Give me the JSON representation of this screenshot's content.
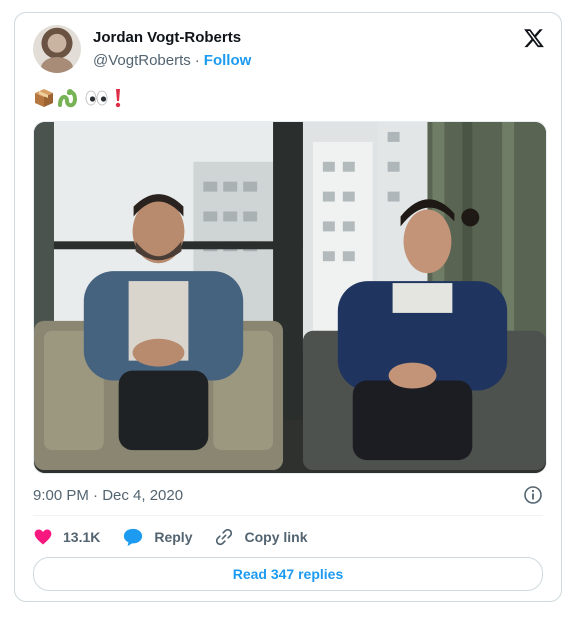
{
  "tweet": {
    "author_name": "Jordan Vogt-Roberts",
    "author_handle": "@VogtRoberts",
    "separator": "·",
    "follow_label": "Follow",
    "emoji_text": [
      "📦",
      "🐍",
      "👀",
      "❗"
    ],
    "timestamp": "9:00 PM · Dec 4, 2020",
    "like_count": "13.1K",
    "reply_label": "Reply",
    "copy_link_label": "Copy link",
    "read_replies_label": "Read 347 replies"
  },
  "icons": {
    "x_logo": "x-logo-icon",
    "info": "info-icon",
    "like": "heart-icon",
    "reply": "speech-bubble-icon",
    "link": "link-icon"
  },
  "colors": {
    "accent": "#1d9bf0",
    "like": "#f91880",
    "secondary_text": "#536471",
    "border": "#cfd9de"
  }
}
